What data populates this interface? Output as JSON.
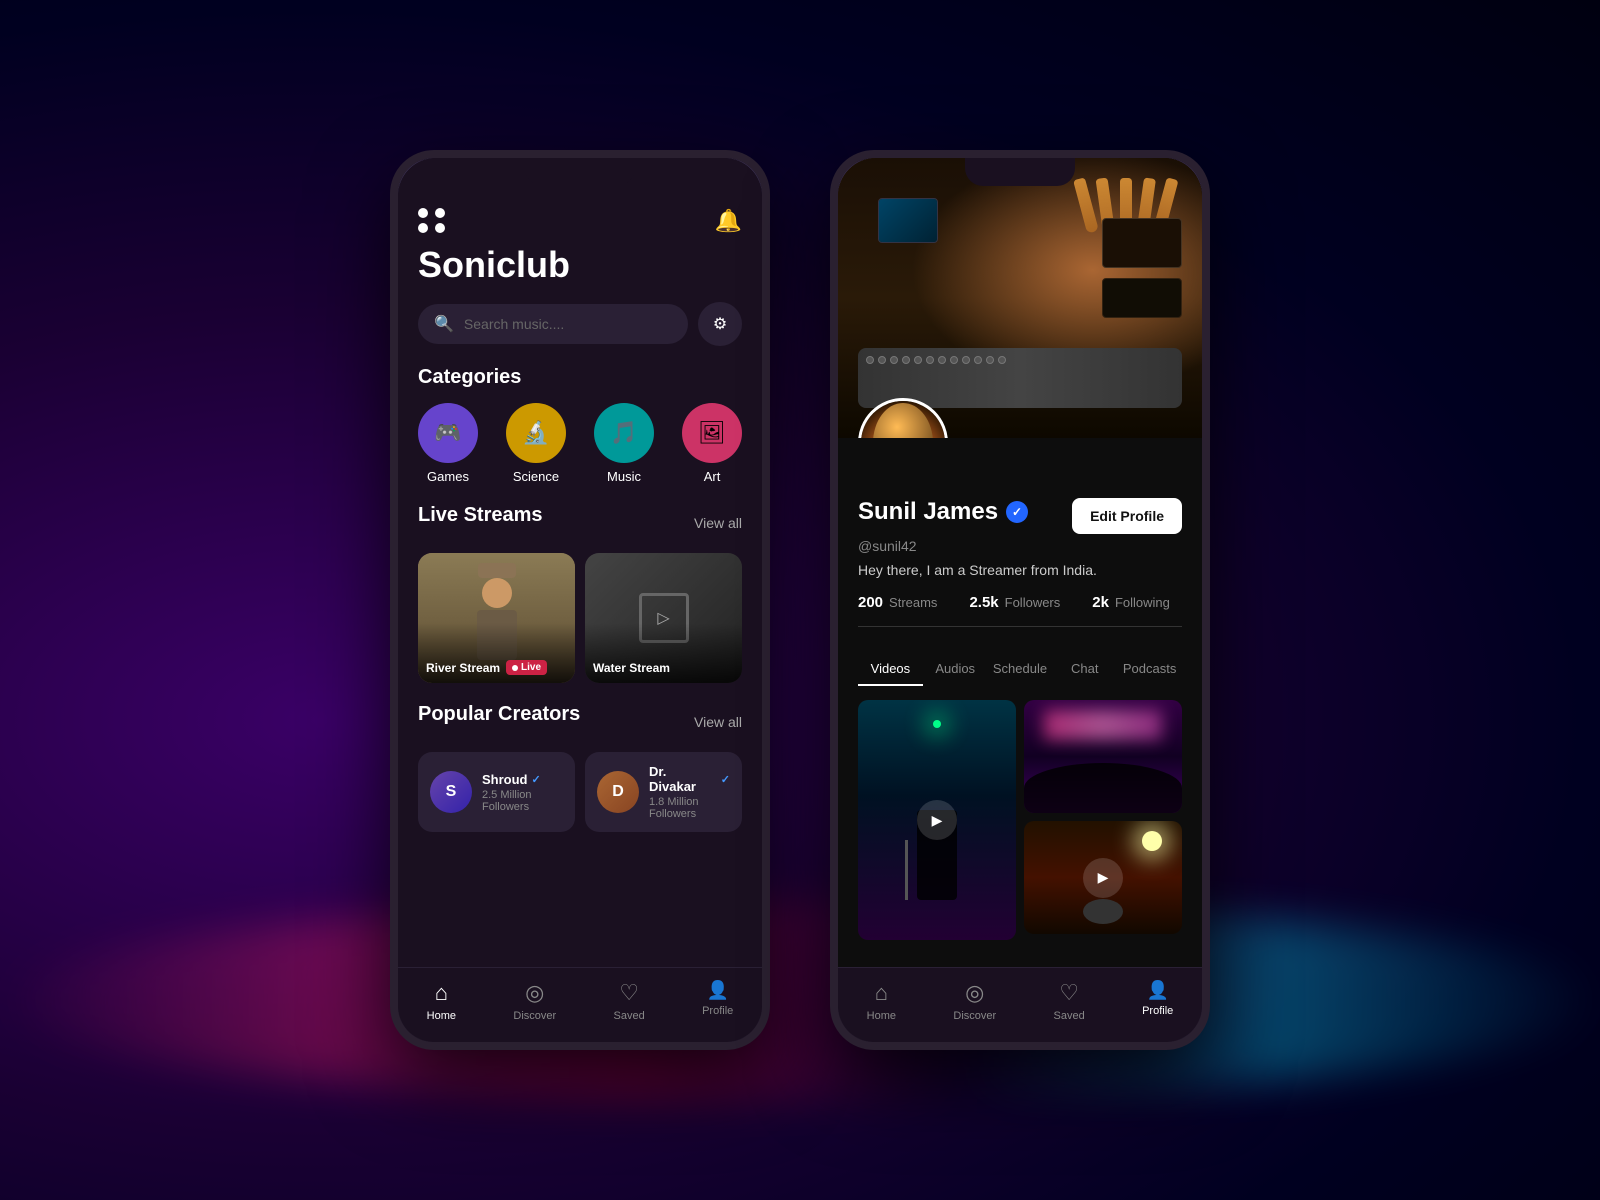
{
  "background": {
    "description": "Dark purple DJ background"
  },
  "phone1": {
    "app_name": "Soniclub",
    "search_placeholder": "Search music....",
    "categories_title": "Categories",
    "categories": [
      {
        "label": "Games",
        "icon": "🎮",
        "color_class": "cat-games"
      },
      {
        "label": "Science",
        "icon": "🔬",
        "color_class": "cat-science"
      },
      {
        "label": "Music",
        "icon": "🎵",
        "color_class": "cat-music"
      },
      {
        "label": "Art",
        "icon": "🖼",
        "color_class": "cat-art"
      }
    ],
    "live_streams_title": "Live Streams",
    "view_all_label": "View all",
    "streams": [
      {
        "name": "River Stream",
        "status": "Live"
      },
      {
        "name": "Water Stream",
        "status": ""
      }
    ],
    "popular_creators_title": "Popular Creators",
    "creators": [
      {
        "name": "Shroud",
        "followers": "2.5 Million Followers",
        "initial": "S"
      },
      {
        "name": "Dr. Divakar",
        "followers": "1.8 Million Followers",
        "initial": "D"
      }
    ],
    "nav": [
      {
        "label": "Home",
        "icon": "⌂",
        "active": true
      },
      {
        "label": "Discover",
        "icon": "◎",
        "active": false
      },
      {
        "label": "Saved",
        "icon": "♡",
        "active": false
      },
      {
        "label": "Profile",
        "icon": "👤",
        "active": false
      }
    ]
  },
  "phone2": {
    "profile": {
      "name": "Sunil James",
      "handle": "@sunil42",
      "bio": "Hey there, I am a Streamer from India.",
      "edit_button": "Edit Profile",
      "stats": [
        {
          "number": "200",
          "label": "Streams"
        },
        {
          "number": "2.5k",
          "label": "Followers"
        },
        {
          "number": "2k",
          "label": "Following"
        }
      ],
      "tabs": [
        {
          "label": "Videos",
          "active": true
        },
        {
          "label": "Audios",
          "active": false
        },
        {
          "label": "Schedule",
          "active": false
        },
        {
          "label": "Chat",
          "active": false
        },
        {
          "label": "Podcasts",
          "active": false
        }
      ]
    },
    "nav": [
      {
        "label": "Home",
        "icon": "⌂",
        "active": false
      },
      {
        "label": "Discover",
        "icon": "◎",
        "active": false
      },
      {
        "label": "Saved",
        "icon": "♡",
        "active": false
      },
      {
        "label": "Profile",
        "icon": "👤",
        "active": true
      }
    ]
  }
}
